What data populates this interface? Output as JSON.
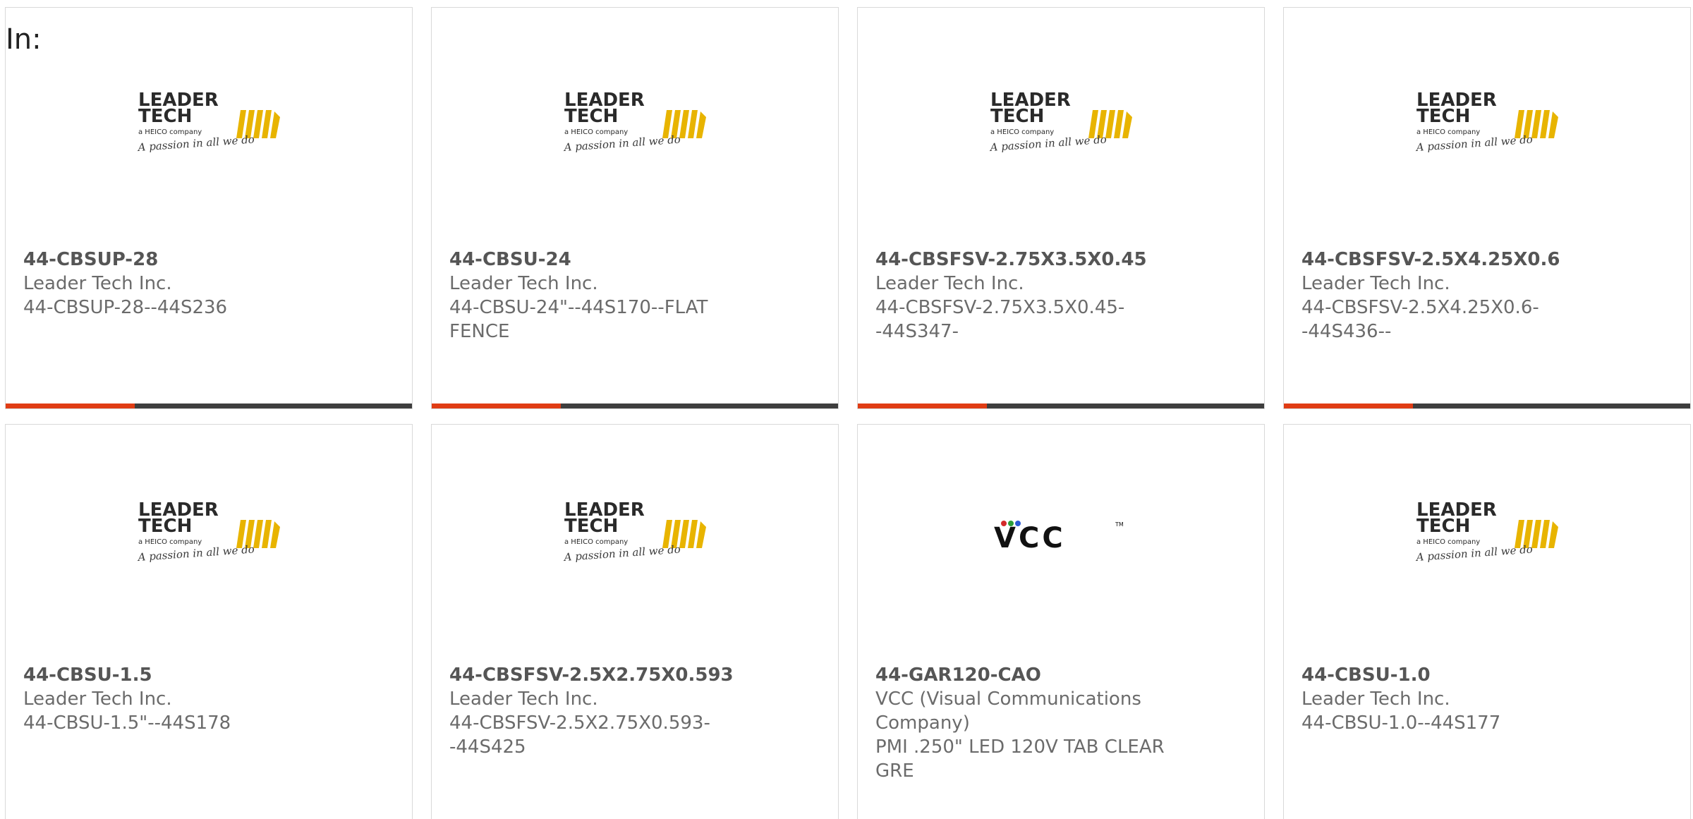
{
  "header": {
    "label": "In:"
  },
  "colors": {
    "accent": "#e03c14",
    "bar": "#3e3e3e",
    "logo_gold": "#e8b400"
  },
  "logos": {
    "leader_tech": {
      "line1": "LEADER",
      "line2": "TECH",
      "line3": "a HEICO company",
      "tagline": "A passion in all we do"
    },
    "vcc": {
      "text": "VCC",
      "tm": "TM"
    }
  },
  "products": [
    {
      "part": "44-CBSUP-28",
      "maker": "Leader Tech Inc.",
      "desc": "44-CBSUP-28--44S236",
      "logo": "leader-tech-logo"
    },
    {
      "part": "44-CBSU-24",
      "maker": "Leader Tech Inc.",
      "desc": "44-CBSU-24\"--44S170--FLAT FENCE",
      "logo": "leader-tech-logo"
    },
    {
      "part": "44-CBSFSV-2.75X3.5X0.45",
      "maker": "Leader Tech Inc.",
      "desc": "44-CBSFSV-2.75X3.5X0.45--44S347-",
      "logo": "leader-tech-logo"
    },
    {
      "part": "44-CBSFSV-2.5X4.25X0.6",
      "maker": "Leader Tech Inc.",
      "desc": "44-CBSFSV-2.5X4.25X0.6--44S436--",
      "logo": "leader-tech-logo"
    },
    {
      "part": "44-CBSU-1.5",
      "maker": "Leader Tech Inc.",
      "desc": "44-CBSU-1.5\"--44S178",
      "logo": "leader-tech-logo"
    },
    {
      "part": "44-CBSFSV-2.5X2.75X0.593",
      "maker": "Leader Tech Inc.",
      "desc": "44-CBSFSV-2.5X2.75X0.593--44S425",
      "logo": "leader-tech-logo"
    },
    {
      "part": "44-GAR120-CAO",
      "maker": "VCC (Visual Communications Company)",
      "desc": "PMI .250\" LED 120V TAB CLEAR GRE",
      "logo": "vcc-logo"
    },
    {
      "part": "44-CBSU-1.0",
      "maker": "Leader Tech Inc.",
      "desc": "44-CBSU-1.0--44S177",
      "logo": "leader-tech-logo"
    }
  ]
}
